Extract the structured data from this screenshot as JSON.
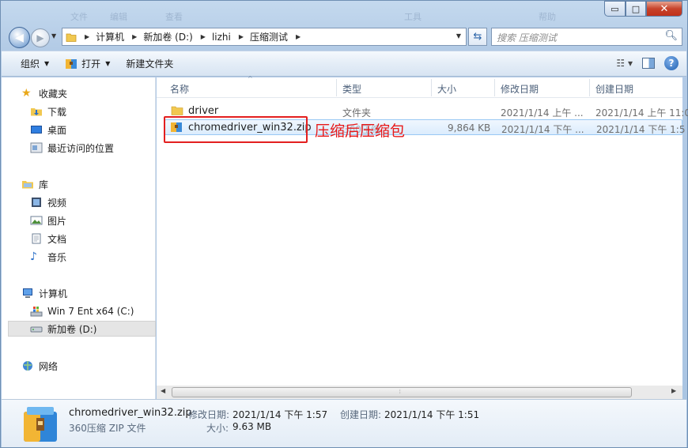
{
  "title_ghost_items": [
    "文件",
    "编辑",
    "查看",
    "工具",
    "帮助"
  ],
  "window_controls": {
    "minimize": "▭",
    "maximize": "□",
    "close": "✕"
  },
  "address": {
    "crumbs": [
      "计算机",
      "新加卷 (D:)",
      "lizhi",
      "压缩测试"
    ]
  },
  "search": {
    "placeholder": "搜索 压缩测试"
  },
  "toolbar": {
    "organize": "组织",
    "open": "打开",
    "new_folder": "新建文件夹"
  },
  "sidebar": {
    "favorites": {
      "label": "收藏夹",
      "items": [
        "下载",
        "桌面",
        "最近访问的位置"
      ]
    },
    "libraries": {
      "label": "库",
      "items": [
        "视频",
        "图片",
        "文档",
        "音乐"
      ]
    },
    "computer": {
      "label": "计算机",
      "items": [
        "Win 7 Ent x64 (C:)",
        "新加卷 (D:)"
      ]
    },
    "network": {
      "label": "网络"
    }
  },
  "columns": {
    "name": "名称",
    "type": "类型",
    "size": "大小",
    "modified": "修改日期",
    "created": "创建日期"
  },
  "files": [
    {
      "name": "driver",
      "type": "文件夹",
      "size": "",
      "modified": "2021/1/14 上午 ...",
      "created": "2021/1/14 上午 11:0"
    },
    {
      "name": "chromedriver_win32.zip",
      "type": "360压缩",
      "size": "9,864 KB",
      "modified": "2021/1/14 下午 ...",
      "created": "2021/1/14 下午 1:5"
    }
  ],
  "annotation": "压缩后压缩包",
  "details": {
    "filename": "chromedriver_win32.zip",
    "filetype": "360压缩 ZIP 文件",
    "modified_label": "修改日期:",
    "modified_value": "2021/1/14 下午 1:57",
    "created_label": "创建日期:",
    "created_value": "2021/1/14 下午 1:51",
    "size_label": "大小:",
    "size_value": "9.63 MB"
  },
  "colors": {
    "annotation_red": "#e81919",
    "selection": "#dbecfd"
  }
}
